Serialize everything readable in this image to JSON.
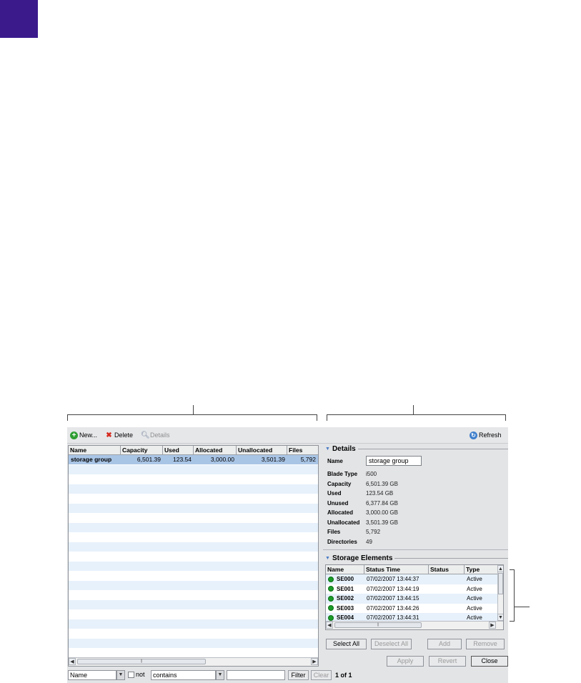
{
  "toolbar": {
    "new_label": "New...",
    "delete_label": "Delete",
    "details_label": "Details",
    "refresh_label": "Refresh"
  },
  "grid": {
    "columns": [
      "Name",
      "Capacity",
      "Used",
      "Allocated",
      "Unallocated",
      "Files"
    ],
    "rows": [
      {
        "name": "storage group",
        "capacity": "6,501.39",
        "used": "123.54",
        "allocated": "3,000.00",
        "unallocated": "3,501.39",
        "files": "5,792"
      }
    ]
  },
  "filter": {
    "field": "Name",
    "not_label": "not",
    "operator": "contains",
    "value": "",
    "filter_button": "Filter",
    "clear_button": "Clear",
    "page_info": "1 of 1"
  },
  "details": {
    "title": "Details",
    "name_label": "Name",
    "name_value": "storage group",
    "fields": [
      {
        "label": "Blade Type",
        "value": "i500"
      },
      {
        "label": "Capacity",
        "value": "6,501.39 GB"
      },
      {
        "label": "Used",
        "value": "123.54 GB"
      },
      {
        "label": "Unused",
        "value": "6,377.84 GB"
      },
      {
        "label": "Allocated",
        "value": "3,000.00 GB"
      },
      {
        "label": "Unallocated",
        "value": "3,501.39 GB"
      },
      {
        "label": "Files",
        "value": "5,792"
      },
      {
        "label": "Directories",
        "value": "49"
      }
    ]
  },
  "storage_elements": {
    "title": "Storage Elements",
    "columns": [
      "Name",
      "Status Time",
      "Status",
      "Type"
    ],
    "rows": [
      {
        "name": "SE000",
        "time": "07/02/2007 13:44:37",
        "status": "",
        "type": "Active"
      },
      {
        "name": "SE001",
        "time": "07/02/2007 13:44:19",
        "status": "",
        "type": "Active"
      },
      {
        "name": "SE002",
        "time": "07/02/2007 13:44:15",
        "status": "",
        "type": "Active"
      },
      {
        "name": "SE003",
        "time": "07/02/2007 13:44:26",
        "status": "",
        "type": "Active"
      },
      {
        "name": "SE004",
        "time": "07/02/2007 13:44:31",
        "status": "",
        "type": "Active"
      }
    ],
    "select_all": "Select All",
    "deselect_all": "Deselect All",
    "add": "Add",
    "remove": "Remove"
  },
  "dialog_buttons": {
    "apply": "Apply",
    "revert": "Revert",
    "close": "Close"
  },
  "colors": {
    "corner_block": "#3b1a8c",
    "selected_row": "#a9c5e6",
    "stripe": "#e7f1fb",
    "status_dot": "#1b9b28"
  }
}
